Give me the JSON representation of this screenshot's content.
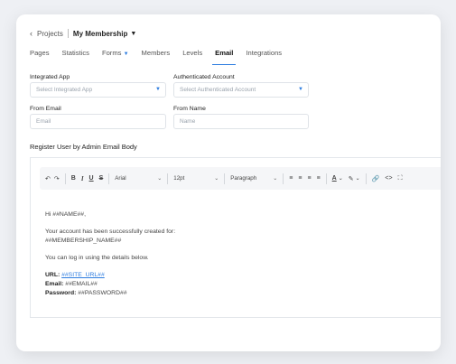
{
  "breadcrumb": {
    "back_icon": "chevron-left-icon",
    "parent": "Projects",
    "current": "My Membership"
  },
  "tabs": [
    {
      "label": "Pages"
    },
    {
      "label": "Statistics"
    },
    {
      "label": "Forms"
    },
    {
      "label": "Members"
    },
    {
      "label": "Levels"
    },
    {
      "label": "Email"
    },
    {
      "label": "Integrations"
    }
  ],
  "active_tab": "Email",
  "form": {
    "integrated_app": {
      "label": "Integrated App",
      "placeholder": "Select Integrated App"
    },
    "authenticated_account": {
      "label": "Authenticated Account",
      "placeholder": "Select Authenticated Account"
    },
    "from_email": {
      "label": "From Email",
      "placeholder": "Email"
    },
    "from_name": {
      "label": "From Name",
      "placeholder": "Name"
    }
  },
  "section_title": "Register User by Admin Email Body",
  "toolbar": {
    "font": "Arial",
    "size": "12pt",
    "block": "Paragraph",
    "bold": "B",
    "italic": "I",
    "underline": "U",
    "strike": "S"
  },
  "email_body": {
    "greeting": "Hi ##NAME##,",
    "line1": "Your account has been successfully created for:",
    "line2": "##MEMBERSHIP_NAME##",
    "line3": "You can log in using the details below.",
    "url_label": "URL:",
    "url_value": "##SITE_URL##",
    "email_label": "Email:",
    "email_value": "##EMAIL##",
    "password_label": "Password:",
    "password_value": "##PASSWORD##"
  },
  "colors": {
    "accent": "#2e7de0",
    "background": "#eef0f4",
    "card": "#ffffff"
  }
}
